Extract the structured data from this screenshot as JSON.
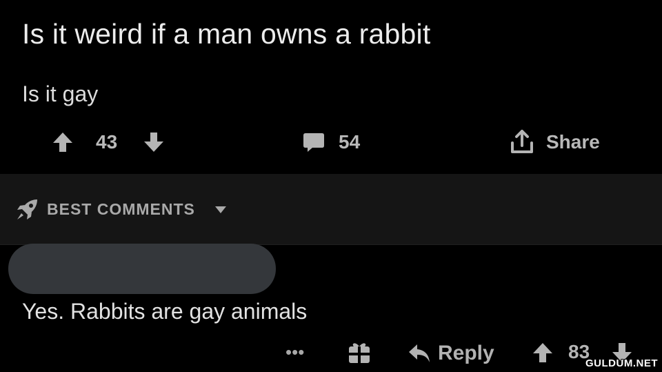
{
  "post": {
    "title": "Is it weird if a man owns a rabbit",
    "body": "Is it gay",
    "votes": "43",
    "comments": "54",
    "share_label": "Share"
  },
  "sort": {
    "label": "BEST COMMENTS"
  },
  "comment": {
    "text": "Yes. Rabbits are gay animals",
    "more_label": "•••",
    "reply_label": "Reply",
    "votes": "83"
  },
  "watermark": "GULDUM.NET",
  "colors": {
    "background": "#000000",
    "sort_bar": "#151515",
    "redaction": "#34373b",
    "icon": "#b4b4b4"
  },
  "icons": [
    "upvote-icon",
    "downvote-icon",
    "comment-icon",
    "share-icon",
    "rocket-icon",
    "caret-down-icon",
    "gift-icon",
    "reply-icon"
  ]
}
